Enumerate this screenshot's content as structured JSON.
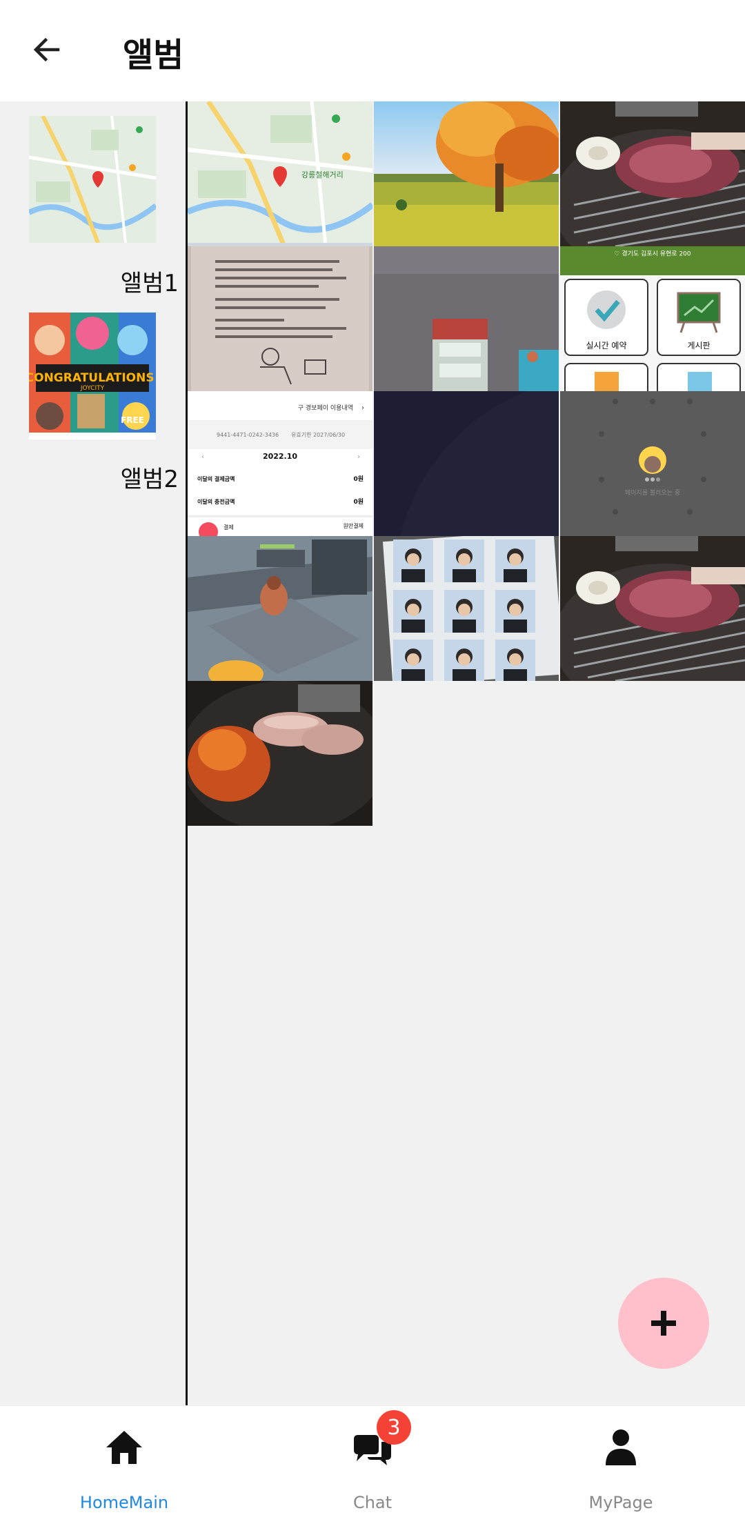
{
  "header": {
    "title": "앨범"
  },
  "albums": [
    {
      "label": "앨범1"
    },
    {
      "label": "앨범2"
    }
  ],
  "album_thumbs": {
    "congrats_text": "CONGRATULATIONS!",
    "joycity_text": "JOYCITY",
    "free_text": "FREE"
  },
  "photos": {
    "map": {
      "place_label": "강릉철해거리"
    },
    "memo_app": {
      "banner": "♡ 경기도 김포시 유현로 200",
      "btn1": "실시간 예약",
      "btn2": "게시판"
    },
    "card_statement": {
      "link": "구 경보페이 이용내역",
      "card_number": "9441-4471-0242-3436",
      "expiry": "유효기한 2027/06/30",
      "month": "2022.10",
      "row1_label": "이달의 결제금액",
      "row1_value": "0원",
      "row2_label": "이달의 충전금액",
      "row2_value": "0원",
      "row3_label": "결제",
      "row3_value": "원만결제"
    },
    "loading": {
      "text": "페이지를 불러오는 중"
    }
  },
  "fab": {
    "icon": "plus-icon"
  },
  "nav": {
    "items": [
      {
        "label": "HomeMain",
        "icon": "home-icon",
        "active": true
      },
      {
        "label": "Chat",
        "icon": "chat-icon",
        "badge": "3"
      },
      {
        "label": "MyPage",
        "icon": "person-icon"
      }
    ],
    "active_color": "#1e88e5",
    "inactive_color": "#888888"
  }
}
